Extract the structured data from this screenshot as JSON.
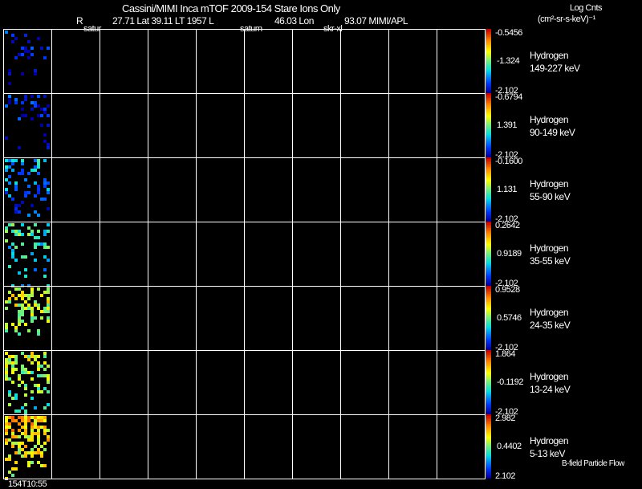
{
  "header": {
    "title": "Cassini/MIMI Inca mTOF  2009-154   Stare   Ions Only",
    "r_label": "R",
    "ephem1": "27.71 Lat 39.11 LT 1957 L",
    "ephem2": "46.03 Lon",
    "ephem3": "93.07  MIMI/APL",
    "marker1": "satur",
    "marker2": "saturn",
    "marker3": "skr-xl",
    "units_line1": "Log Cnts",
    "units_line2": "(cm²-sr-s-keV)⁻¹"
  },
  "footer": {
    "time": "154T10:55",
    "legend_note": "B-field Particle Flow"
  },
  "chart_data": {
    "type": "heatmap",
    "colormap": "rainbow (blue-cyan-green-yellow-red)",
    "columns": 10,
    "panels": [
      {
        "species": "Hydrogen",
        "energy": "149-227 keV",
        "cb_max": "-0.5456",
        "cb_mid": "-1.324",
        "cb_min": "-2.102"
      },
      {
        "species": "Hydrogen",
        "energy": "90-149 keV",
        "cb_max": "-0.6794",
        "cb_mid": "1.391",
        "cb_min": "-2.102"
      },
      {
        "species": "Hydrogen",
        "energy": "55-90 keV",
        "cb_max": "-0.1600",
        "cb_mid": "1.131",
        "cb_min": "-2.102"
      },
      {
        "species": "Hydrogen",
        "energy": "35-55 keV",
        "cb_max": "0.2642",
        "cb_mid": "0.9189",
        "cb_min": "-2.102"
      },
      {
        "species": "Hydrogen",
        "energy": "24-35 keV",
        "cb_max": "0.9528",
        "cb_mid": "0.5746",
        "cb_min": "-2.102"
      },
      {
        "species": "Hydrogen",
        "energy": "13-24 keV",
        "cb_max": "1.864",
        "cb_mid": "-0.1192",
        "cb_min": "-2.102"
      },
      {
        "species": "Hydrogen",
        "energy": "5-13 keV",
        "cb_max": "2.982",
        "cb_mid": "0.4402",
        "cb_min": "2.102"
      }
    ]
  }
}
